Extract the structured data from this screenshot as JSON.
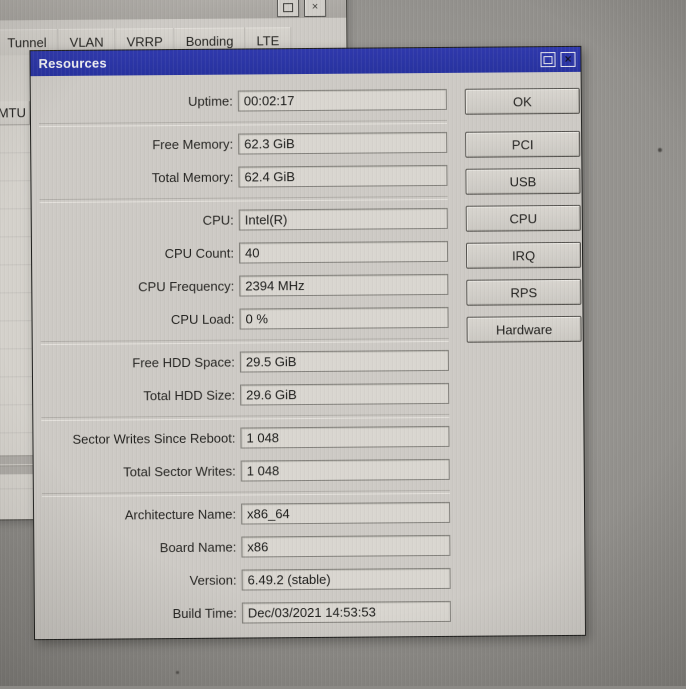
{
  "background_window": {
    "tabs": [
      "Tunnel",
      "VLAN",
      "VRRP",
      "Bonding",
      "LTE"
    ],
    "mtu_header": "MTU",
    "close_glyph": "×"
  },
  "dialog": {
    "title": "Resources",
    "close_glyph": "×",
    "fields": [
      {
        "label": "Uptime:",
        "value": "00:02:17"
      },
      {
        "label": "Free Memory:",
        "value": "62.3 GiB"
      },
      {
        "label": "Total Memory:",
        "value": "62.4 GiB"
      },
      {
        "label": "CPU:",
        "value": "Intel(R)"
      },
      {
        "label": "CPU Count:",
        "value": "40"
      },
      {
        "label": "CPU Frequency:",
        "value": "2394 MHz"
      },
      {
        "label": "CPU Load:",
        "value": "0 %"
      },
      {
        "label": "Free HDD Space:",
        "value": "29.5 GiB"
      },
      {
        "label": "Total HDD Size:",
        "value": "29.6 GiB"
      },
      {
        "label": "Sector Writes Since Reboot:",
        "value": "1 048"
      },
      {
        "label": "Total Sector Writes:",
        "value": "1 048"
      },
      {
        "label": "Architecture Name:",
        "value": "x86_64"
      },
      {
        "label": "Board Name:",
        "value": "x86"
      },
      {
        "label": "Version:",
        "value": "6.49.2 (stable)"
      },
      {
        "label": "Build Time:",
        "value": "Dec/03/2021 14:53:53"
      }
    ],
    "buttons": [
      "OK",
      "PCI",
      "USB",
      "CPU",
      "IRQ",
      "RPS",
      "Hardware"
    ]
  },
  "colors": {
    "titlebar_blue": "#2831a4",
    "dialog_face": "#cfccc6",
    "field_fill": "#dbd8d2",
    "desktop_gray": "#8c8a86"
  }
}
